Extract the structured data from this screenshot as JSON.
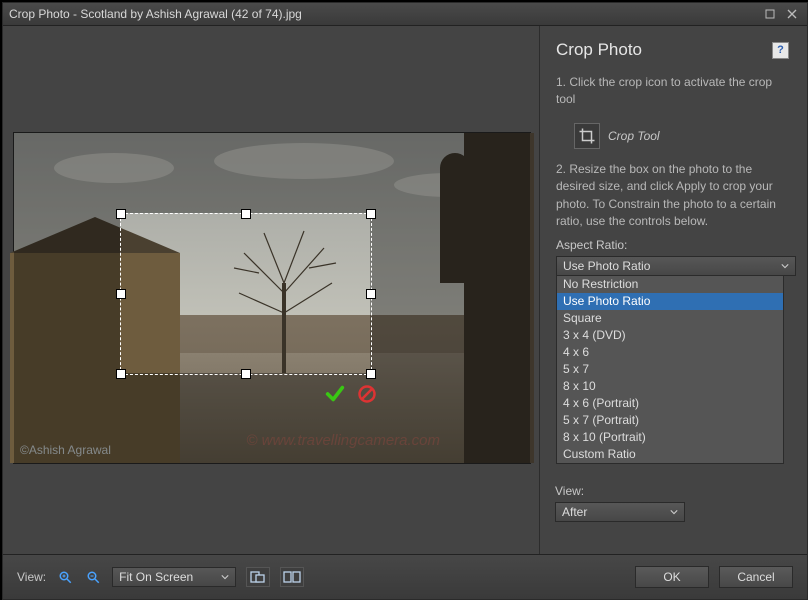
{
  "window": {
    "title": "Crop Photo - Scotland by Ashish Agrawal (42 of 74).jpg"
  },
  "panel": {
    "heading": "Crop Photo",
    "step1": "1. Click the crop icon to activate the crop tool",
    "crop_tool_label": "Crop Tool",
    "step2": "2. Resize the box on the photo to the desired size, and click Apply to crop your photo. To Constrain the photo to a certain ratio, use the controls below.",
    "aspect_label": "Aspect Ratio:",
    "aspect_value": "Use Photo Ratio",
    "aspect_options": [
      "No Restriction",
      "Use Photo Ratio",
      "Square",
      "3 x 4 (DVD)",
      "4 x 6",
      "5 x 7",
      "8 x 10",
      "4 x 6 (Portrait)",
      "5 x 7 (Portrait)",
      "8 x 10 (Portrait)",
      "Custom Ratio"
    ],
    "view_label": "View:",
    "view_value": "After"
  },
  "footer": {
    "view_label": "View:",
    "zoom_label": "Fit On Screen",
    "ok": "OK",
    "cancel": "Cancel"
  },
  "watermark": {
    "left": "©Ashish Agrawal",
    "right": "© www.travellingcamera.com"
  }
}
